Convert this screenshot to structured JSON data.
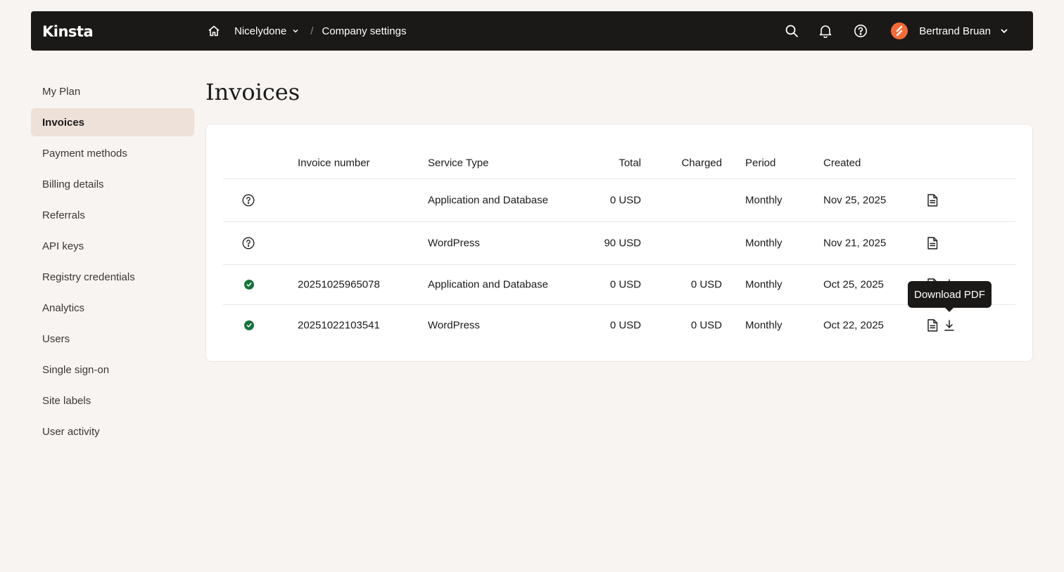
{
  "header": {
    "logo": "Kinsta",
    "breadcrumb": {
      "company": "Nicelydone",
      "separator": "/",
      "page": "Company settings"
    },
    "user": {
      "name": "Bertrand Bruan"
    },
    "icons": [
      "home-icon",
      "chevron-down-icon",
      "search-icon",
      "bell-icon",
      "help-icon",
      "avatar",
      "chevron-down-icon"
    ]
  },
  "sidebar": {
    "items": [
      {
        "label": "My Plan"
      },
      {
        "label": "Invoices",
        "active": true
      },
      {
        "label": "Payment methods"
      },
      {
        "label": "Billing details"
      },
      {
        "label": "Referrals"
      },
      {
        "label": "API keys"
      },
      {
        "label": "Registry credentials"
      },
      {
        "label": "Analytics"
      },
      {
        "label": "Users"
      },
      {
        "label": "Single sign-on"
      },
      {
        "label": "Site labels"
      },
      {
        "label": "User activity"
      }
    ]
  },
  "main": {
    "title": "Invoices",
    "table": {
      "columns": {
        "number": "Invoice number",
        "type": "Service Type",
        "total": "Total",
        "charged": "Charged",
        "period": "Period",
        "created": "Created"
      },
      "rows": [
        {
          "status": "pending",
          "number": "",
          "type": "Application and Database",
          "total": "0 USD",
          "charged": "",
          "period": "Monthly",
          "created": "Nov 25, 2025"
        },
        {
          "status": "pending",
          "number": "",
          "type": "WordPress",
          "total": "90 USD",
          "charged": "",
          "period": "Monthly",
          "created": "Nov 21, 2025"
        },
        {
          "status": "paid",
          "number": "20251025965078",
          "type": "Application and Database",
          "total": "0 USD",
          "charged": "0 USD",
          "period": "Monthly",
          "created": "Oct 25, 2025"
        },
        {
          "status": "paid",
          "number": "20251022103541",
          "type": "WordPress",
          "total": "0 USD",
          "charged": "0 USD",
          "period": "Monthly",
          "created": "Oct 22, 2025"
        }
      ]
    },
    "tooltip": "Download PDF"
  },
  "colors": {
    "topbar": "#1b1918",
    "background": "#f8f4f1",
    "active_nav": "#ede1da",
    "paid": "#17733d",
    "accent": "#f26b38"
  }
}
